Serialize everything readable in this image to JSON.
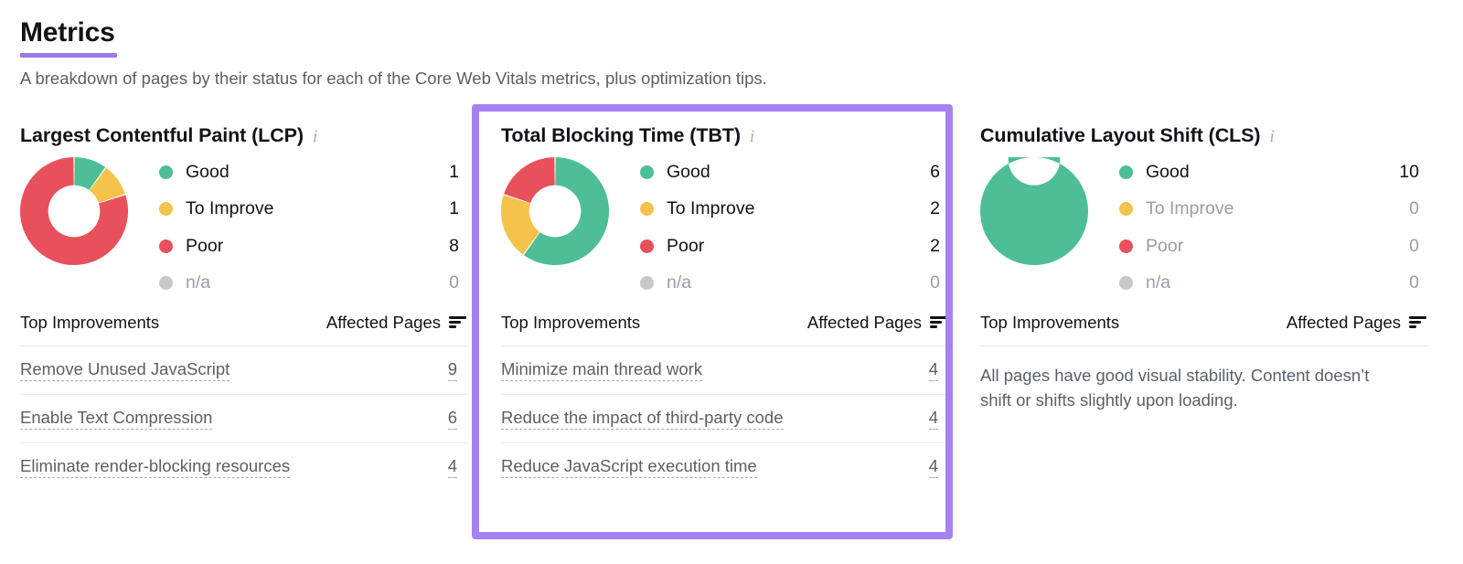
{
  "header": {
    "title": "Metrics",
    "subtitle": "A breakdown of pages by their status for each of the Core Web Vitals metrics, plus optimization tips.",
    "accent_color": "#9B7BE8"
  },
  "status_colors": {
    "good": "#4EBE96",
    "to_improve": "#F5C24B",
    "poor": "#E8505B",
    "na": "#C6C8CC"
  },
  "table_headers": {
    "left": "Top Improvements",
    "right": "Affected Pages",
    "sort_icon": "sort-descending-icon"
  },
  "info_icon": "i",
  "cards": [
    {
      "id": "lcp",
      "title": "Largest Contentful Paint (LCP)",
      "highlighted": false,
      "legend": [
        {
          "label": "Good",
          "value": "1",
          "color_key": "good",
          "muted": false
        },
        {
          "label": "To Improve",
          "value": "1",
          "color_key": "to_improve",
          "muted": false
        },
        {
          "label": "Poor",
          "value": "8",
          "color_key": "poor",
          "muted": false
        },
        {
          "label": "n/a",
          "value": "0",
          "color_key": "na",
          "muted": true
        }
      ],
      "improvements": [
        {
          "name": "Remove Unused JavaScript",
          "pages": "9"
        },
        {
          "name": "Enable Text Compression",
          "pages": "6"
        },
        {
          "name": "Eliminate render-blocking resources",
          "pages": "4"
        }
      ],
      "note": ""
    },
    {
      "id": "tbt",
      "title": "Total Blocking Time (TBT)",
      "highlighted": true,
      "legend": [
        {
          "label": "Good",
          "value": "6",
          "color_key": "good",
          "muted": false
        },
        {
          "label": "To Improve",
          "value": "2",
          "color_key": "to_improve",
          "muted": false
        },
        {
          "label": "Poor",
          "value": "2",
          "color_key": "poor",
          "muted": false
        },
        {
          "label": "n/a",
          "value": "0",
          "color_key": "na",
          "muted": true
        }
      ],
      "improvements": [
        {
          "name": "Minimize main thread work",
          "pages": "4"
        },
        {
          "name": "Reduce the impact of third-party code",
          "pages": "4"
        },
        {
          "name": "Reduce JavaScript execution time",
          "pages": "4"
        }
      ],
      "note": ""
    },
    {
      "id": "cls",
      "title": "Cumulative Layout Shift (CLS)",
      "highlighted": false,
      "legend": [
        {
          "label": "Good",
          "value": "10",
          "color_key": "good",
          "muted": false
        },
        {
          "label": "To Improve",
          "value": "0",
          "color_key": "to_improve",
          "muted": true
        },
        {
          "label": "Poor",
          "value": "0",
          "color_key": "poor",
          "muted": true
        },
        {
          "label": "n/a",
          "value": "0",
          "color_key": "na",
          "muted": true
        }
      ],
      "improvements": [],
      "note": "All pages have good visual stability. Content doesn’t shift or shifts slightly upon loading."
    }
  ],
  "chart_data": [
    {
      "type": "pie",
      "title": "Largest Contentful Paint (LCP)",
      "categories": [
        "Good",
        "To Improve",
        "Poor",
        "n/a"
      ],
      "values": [
        1,
        1,
        8,
        0
      ],
      "colors": [
        "#4EBE96",
        "#F5C24B",
        "#E8505B",
        "#C6C8CC"
      ],
      "donut": true,
      "hole_ratio": 0.48,
      "legend": "right",
      "total": 10
    },
    {
      "type": "pie",
      "title": "Total Blocking Time (TBT)",
      "categories": [
        "Good",
        "To Improve",
        "Poor",
        "n/a"
      ],
      "values": [
        6,
        2,
        2,
        0
      ],
      "colors": [
        "#4EBE96",
        "#F5C24B",
        "#E8505B",
        "#C6C8CC"
      ],
      "donut": true,
      "hole_ratio": 0.48,
      "legend": "right",
      "total": 10
    },
    {
      "type": "pie",
      "title": "Cumulative Layout Shift (CLS)",
      "categories": [
        "Good",
        "To Improve",
        "Poor",
        "n/a"
      ],
      "values": [
        10,
        0,
        0,
        0
      ],
      "colors": [
        "#4EBE96",
        "#F5C24B",
        "#E8505B",
        "#C6C8CC"
      ],
      "donut": true,
      "hole_ratio": 0.48,
      "legend": "right",
      "total": 10
    }
  ]
}
